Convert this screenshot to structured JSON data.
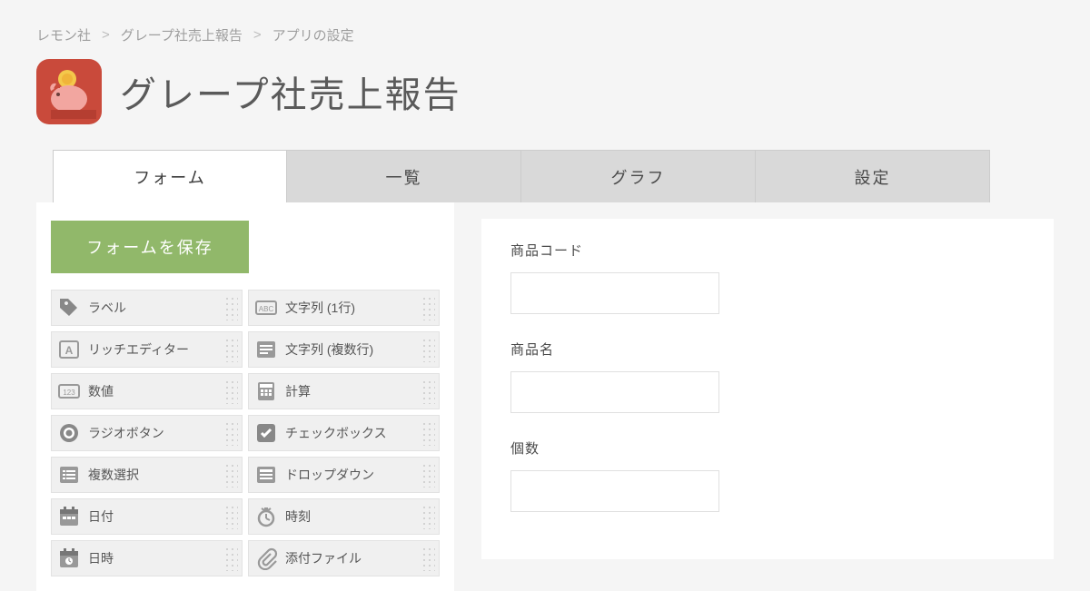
{
  "breadcrumb": {
    "items": [
      "レモン社",
      "グレープ社売上報告",
      "アプリの設定"
    ]
  },
  "title": "グレープ社売上報告",
  "tabs": [
    {
      "label": "フォーム",
      "active": true
    },
    {
      "label": "一覧",
      "active": false
    },
    {
      "label": "グラフ",
      "active": false
    },
    {
      "label": "設定",
      "active": false
    }
  ],
  "save_button": "フォームを保存",
  "palette": [
    {
      "icon": "tag",
      "label": "ラベル"
    },
    {
      "icon": "abc",
      "label": "文字列 (1行)"
    },
    {
      "icon": "richtext",
      "label": "リッチエディター"
    },
    {
      "icon": "multiline",
      "label": "文字列 (複数行)"
    },
    {
      "icon": "num",
      "label": "数値"
    },
    {
      "icon": "calc",
      "label": "計算"
    },
    {
      "icon": "radio",
      "label": "ラジオボタン"
    },
    {
      "icon": "check",
      "label": "チェックボックス"
    },
    {
      "icon": "multisel",
      "label": "複数選択"
    },
    {
      "icon": "dropdown",
      "label": "ドロップダウン"
    },
    {
      "icon": "date",
      "label": "日付"
    },
    {
      "icon": "time",
      "label": "時刻"
    },
    {
      "icon": "datetime",
      "label": "日時"
    },
    {
      "icon": "attach",
      "label": "添付ファイル"
    }
  ],
  "form_fields": [
    {
      "label": "商品コード"
    },
    {
      "label": "商品名"
    },
    {
      "label": "個数"
    }
  ]
}
